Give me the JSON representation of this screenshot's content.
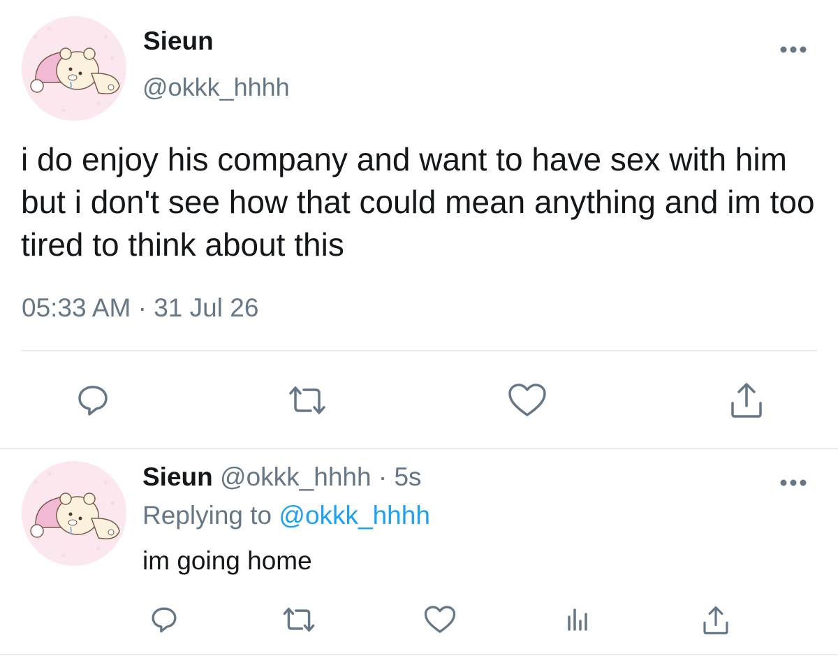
{
  "main_tweet": {
    "display_name": "Sieun",
    "handle": "@okkk_hhhh",
    "text": "i do enjoy his company and want to have sex with him but i don't see how that could mean anything and im too tired to think about this",
    "time": "05:33 AM",
    "separator": "·",
    "date": "31 Jul 26",
    "more_icon": "more-dots-icon",
    "actions": [
      "reply-icon",
      "retweet-icon",
      "like-icon",
      "share-icon"
    ]
  },
  "reply_tweet": {
    "display_name": "Sieun",
    "handle": "@okkk_hhhh",
    "separator": "·",
    "age": "5s",
    "replying_prefix": "Replying to",
    "replying_handle": "@okkk_hhhh",
    "text": "im going home",
    "more_icon": "more-dots-icon",
    "actions": [
      "reply-icon",
      "retweet-icon",
      "like-icon",
      "analytics-icon",
      "share-icon"
    ]
  },
  "colors": {
    "text": "#14171a",
    "muted": "#657786",
    "link": "#1da1f2",
    "divider": "#e6ecf0",
    "avatar_bg": "#fbe7ee"
  }
}
